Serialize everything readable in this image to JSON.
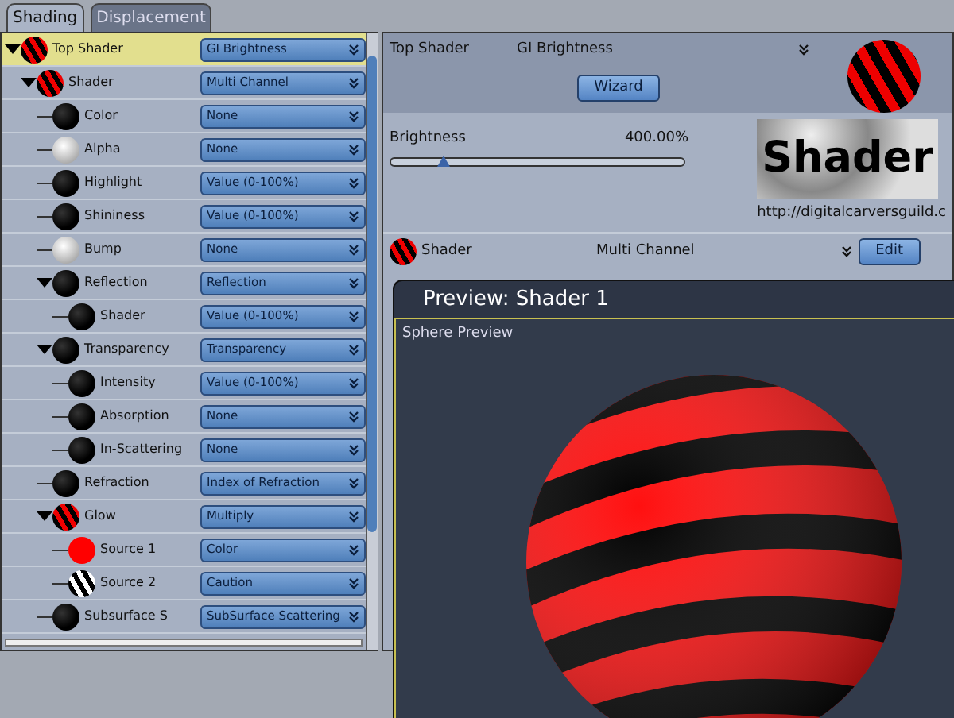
{
  "tabs": [
    {
      "label": "Shading",
      "selected": true
    },
    {
      "label": "Displacement",
      "selected": false
    }
  ],
  "tree": [
    {
      "label": "Top Shader",
      "kind": "striped",
      "value": "GI Brightness",
      "selected": true,
      "expanded": true,
      "children": [
        {
          "label": "Shader",
          "kind": "striped",
          "value": "Multi Channel",
          "selected": false,
          "expanded": true,
          "children": [
            {
              "label": "Color",
              "kind": "black",
              "value": "None",
              "selected": false
            },
            {
              "label": "Alpha",
              "kind": "white",
              "value": "None",
              "selected": false
            },
            {
              "label": "Highlight",
              "kind": "black",
              "value": "Value (0-100%)",
              "selected": false
            },
            {
              "label": "Shininess",
              "kind": "black",
              "value": "Value (0-100%)",
              "selected": false
            },
            {
              "label": "Bump",
              "kind": "white",
              "value": "None",
              "selected": false
            },
            {
              "label": "Reflection",
              "kind": "black",
              "value": "Reflection",
              "selected": false,
              "expanded": true,
              "children": [
                {
                  "label": "Shader",
                  "kind": "black",
                  "value": "Value (0-100%)",
                  "selected": false
                }
              ]
            },
            {
              "label": "Transparency",
              "kind": "black",
              "value": "Transparency",
              "selected": false,
              "expanded": true,
              "children": [
                {
                  "label": "Intensity",
                  "kind": "black",
                  "value": "Value (0-100%)",
                  "selected": false
                },
                {
                  "label": "Absorption",
                  "kind": "black",
                  "value": "None",
                  "selected": false
                },
                {
                  "label": "In-Scattering",
                  "kind": "black",
                  "value": "None",
                  "selected": false
                }
              ]
            },
            {
              "label": "Refraction",
              "kind": "black",
              "value": "Index of Refraction",
              "selected": false
            },
            {
              "label": "Glow",
              "kind": "striped",
              "value": "Multiply",
              "selected": false,
              "expanded": true,
              "children": [
                {
                  "label": "Source 1",
                  "kind": "red",
                  "value": "Color",
                  "selected": false
                },
                {
                  "label": "Source 2",
                  "kind": "bwstriped",
                  "value": "Caution",
                  "selected": false
                }
              ]
            },
            {
              "label": "Subsurface S",
              "kind": "black",
              "value": "SubSurface Scattering",
              "selected": false
            }
          ]
        }
      ]
    }
  ],
  "editor": {
    "header": {
      "name": "Top Shader",
      "value": "GI Brightness",
      "button": "Wizard"
    },
    "slider": {
      "label": "Brightness",
      "reading": "400.00%",
      "level": 0.18
    },
    "banner": {
      "text": "Shader",
      "url": "http://digitalcarversguild.c"
    },
    "shader_row": {
      "name": "Shader",
      "value": "Multi Channel",
      "button": "Edit"
    }
  },
  "preview": {
    "title": "Preview: Shader 1",
    "caption": "Sphere Preview"
  }
}
